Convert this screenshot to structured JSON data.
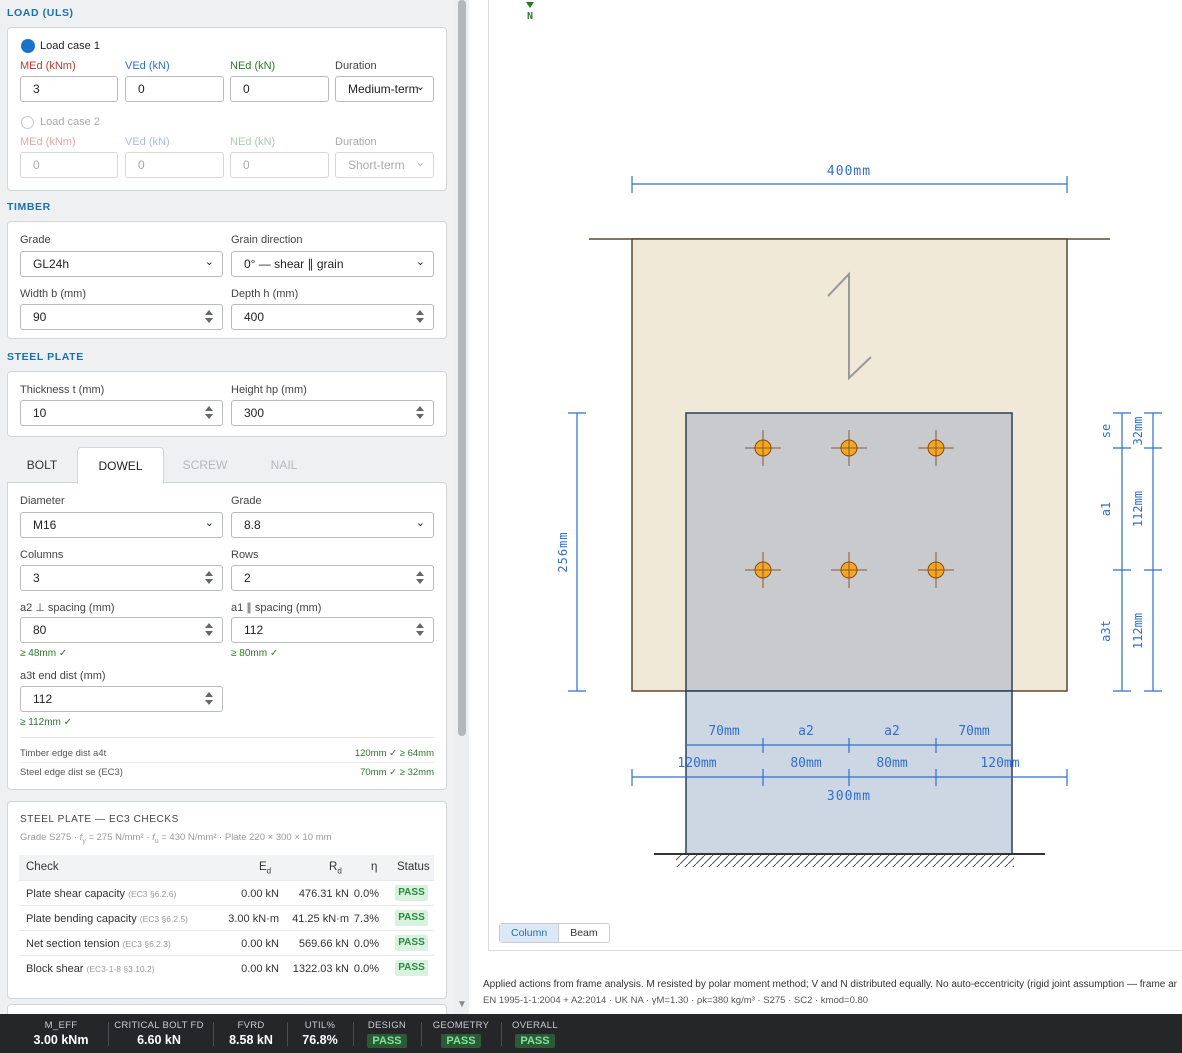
{
  "load": {
    "section_title": "LOAD (ULS)",
    "case1": {
      "label": "Load case 1",
      "med_label": "MEd (kNm)",
      "ved_label": "VEd (kN)",
      "ned_label": "NEd (kN)",
      "dur_label": "Duration",
      "med": "3",
      "ved": "0",
      "ned": "0",
      "duration": "Medium-term",
      "selected": true
    },
    "case2": {
      "label": "Load case 2",
      "med_label": "MEd (kNm)",
      "ved_label": "VEd (kN)",
      "ned_label": "NEd (kN)",
      "dur_label": "Duration",
      "med": "0",
      "ved": "0",
      "ned": "0",
      "duration": "Short-term",
      "selected": false
    }
  },
  "timber": {
    "section_title": "TIMBER",
    "grade_label": "Grade",
    "grade": "GL24h",
    "grain_label": "Grain direction",
    "grain": "0° — shear ∥ grain",
    "width_label": "Width b (mm)",
    "width": "90",
    "depth_label": "Depth h (mm)",
    "depth": "400"
  },
  "steel_plate": {
    "section_title": "STEEL PLATE",
    "thickness_label": "Thickness t (mm)",
    "thickness": "10",
    "height_label": "Height hp (mm)",
    "height": "300"
  },
  "fastener_tabs": [
    "BOLT",
    "DOWEL",
    "SCREW",
    "NAIL"
  ],
  "active_tab": "DOWEL",
  "dowel": {
    "diameter_label": "Diameter",
    "diameter": "M16",
    "grade_label": "Grade",
    "grade": "8.8",
    "columns_label": "Columns",
    "columns": "3",
    "rows_label": "Rows",
    "rows": "2",
    "a2_label": "a2 ⊥ spacing (mm)",
    "a2": "80",
    "a2_check": "≥ 48mm ✓",
    "a1_label": "a1 ∥ spacing (mm)",
    "a1": "112",
    "a1_check": "≥ 80mm ✓",
    "a3t_label": "a3t end dist (mm)",
    "a3t": "112",
    "a3t_check": "≥ 112mm ✓",
    "timber_edge_label": "Timber edge dist a4t",
    "timber_edge_value": "120mm ✓ ≥ 64mm",
    "steel_edge_label": "Steel edge dist se (EC3)",
    "steel_edge_value": "70mm ✓ ≥ 32mm"
  },
  "checks": {
    "title": "STEEL PLATE — EC3 CHECKS",
    "subtitle_parts": [
      "Grade S275 · ",
      "f",
      "y",
      " = 275 N/mm² · ",
      "f",
      "u",
      " = 430 N/mm² · Plate 220 × 300 × 10 mm"
    ],
    "headers": {
      "check": "Check",
      "ed": "E",
      "ed_sub": "d",
      "rd": "R",
      "rd_sub": "d",
      "eta": "η",
      "status": "Status"
    },
    "rows": [
      {
        "name": "Plate shear capacity",
        "ref": "(EC3 §6.2.6)",
        "ed": "0.00 kN",
        "rd": "476.31 kN",
        "eta": "0.0%",
        "status": "PASS"
      },
      {
        "name": "Plate bending capacity",
        "ref": "(EC3 §6.2.5)",
        "ed": "3.00 kN·m",
        "rd": "41.25 kN·m",
        "eta": "7.3%",
        "status": "PASS"
      },
      {
        "name": "Net section tension",
        "ref": "(EC3 §6.2.3)",
        "ed": "0.00 kN",
        "rd": "569.66 kN",
        "eta": "0.0%",
        "status": "PASS"
      },
      {
        "name": "Block shear",
        "ref": "(EC3-1-8 §3.10.2)",
        "ed": "0.00 kN",
        "rd": "1322.03 kN",
        "eta": "0.0%",
        "status": "PASS"
      }
    ]
  },
  "drawing": {
    "north": "N",
    "dim_width": "400mm",
    "dim_left": "256mm",
    "dim_right_labels": [
      "se",
      "a1",
      "a3t"
    ],
    "dim_right_values": [
      "32mm",
      "112mm",
      "112mm"
    ],
    "row_top": [
      "70mm",
      "a2",
      "a2",
      "70mm"
    ],
    "row_mid": [
      "120mm",
      "80mm",
      "80mm",
      "120mm"
    ],
    "dim_plate": "300mm",
    "view_options": [
      "Column",
      "Beam"
    ],
    "active_view": "Column"
  },
  "footnote": {
    "line1": "Applied actions from frame analysis. M resisted by polar moment method; V and N distributed equally. No auto-eccentricity (rigid joint assumption — frame ar",
    "line2": "EN 1995-1-1:2004 + A2:2014  ·  UK NA  ·  γM=1.30  ·  ρk=380 kg/m³  ·  S275  ·  SC2  ·  kmod=0.80"
  },
  "summary": [
    {
      "key": "M_EFF",
      "value": "3.00 kNm"
    },
    {
      "key": "CRITICAL BOLT FD",
      "value": "6.60 kN"
    },
    {
      "key": "FVRD",
      "value": "8.58 kN"
    },
    {
      "key": "UTIL%",
      "value": "76.8%"
    },
    {
      "key": "DESIGN",
      "value": "PASS"
    },
    {
      "key": "GEOMETRY",
      "value": "PASS"
    },
    {
      "key": "OVERALL",
      "value": "PASS"
    }
  ],
  "colors": {
    "accent": "#1e6fb0",
    "med": "#c0392b",
    "ved": "#2f6fd1",
    "ned": "#2a7a2a",
    "timber": "#f1e9d8",
    "plate": "#c9ccd0",
    "dowel": "#f5a623"
  }
}
